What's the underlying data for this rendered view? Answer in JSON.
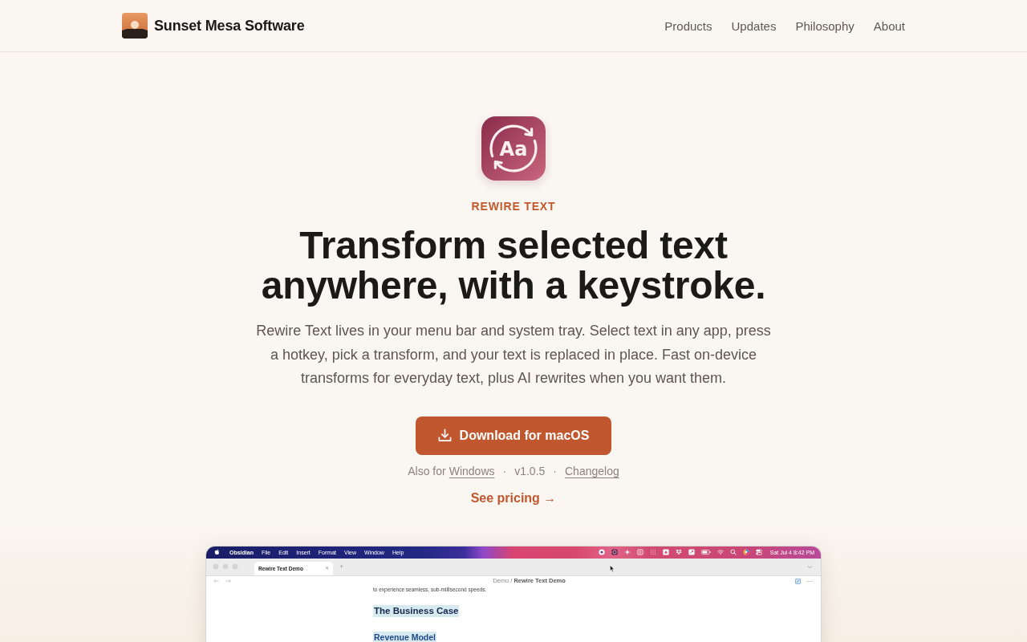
{
  "header": {
    "brand": "Sunset Mesa Software",
    "nav": [
      {
        "label": "Products"
      },
      {
        "label": "Updates"
      },
      {
        "label": "Philosophy"
      },
      {
        "label": "About"
      }
    ]
  },
  "hero": {
    "app_icon_text": "Aa",
    "eyebrow": "REWIRE TEXT",
    "title": "Transform selected text anywhere, with a keystroke.",
    "description": "Rewire Text lives in your menu bar and system tray. Select text in any app, press a hotkey, pick a transform, and your text is replaced in place. Fast on-device transforms for everyday text, plus AI rewrites when you want them.",
    "download_button": "Download for macOS",
    "meta": [
      {
        "kind": "text",
        "text": "Also for"
      },
      {
        "kind": "link",
        "text": "Windows"
      },
      {
        "kind": "separator",
        "text": "·"
      },
      {
        "kind": "text",
        "text": "v1.0.5"
      },
      {
        "kind": "separator",
        "text": "·"
      },
      {
        "kind": "link",
        "text": "Changelog"
      }
    ],
    "pricing_link": "See pricing →"
  },
  "demo_window": {
    "menu_bar": {
      "app": "Obsidian",
      "menus": [
        "File",
        "Edit",
        "Insert",
        "Format",
        "View",
        "Window",
        "Help"
      ],
      "clock": "Sat Jul 4 8:42 PM"
    },
    "tabs": [
      {
        "label": "Rewire Text Demo",
        "selected": true,
        "close": "×"
      }
    ],
    "new_tab": "+",
    "breadcrumb": "Demo / **Rewire Text Demo**",
    "document": [
      {
        "kind": "paragraph",
        "text": "to experience seamless, sub-millisecond speeds.",
        "selected": false
      },
      {
        "kind": "heading1",
        "text": "The Business Case",
        "selected": true
      },
      {
        "kind": "heading2",
        "text": "Revenue Model",
        "selected": true
      }
    ]
  }
}
